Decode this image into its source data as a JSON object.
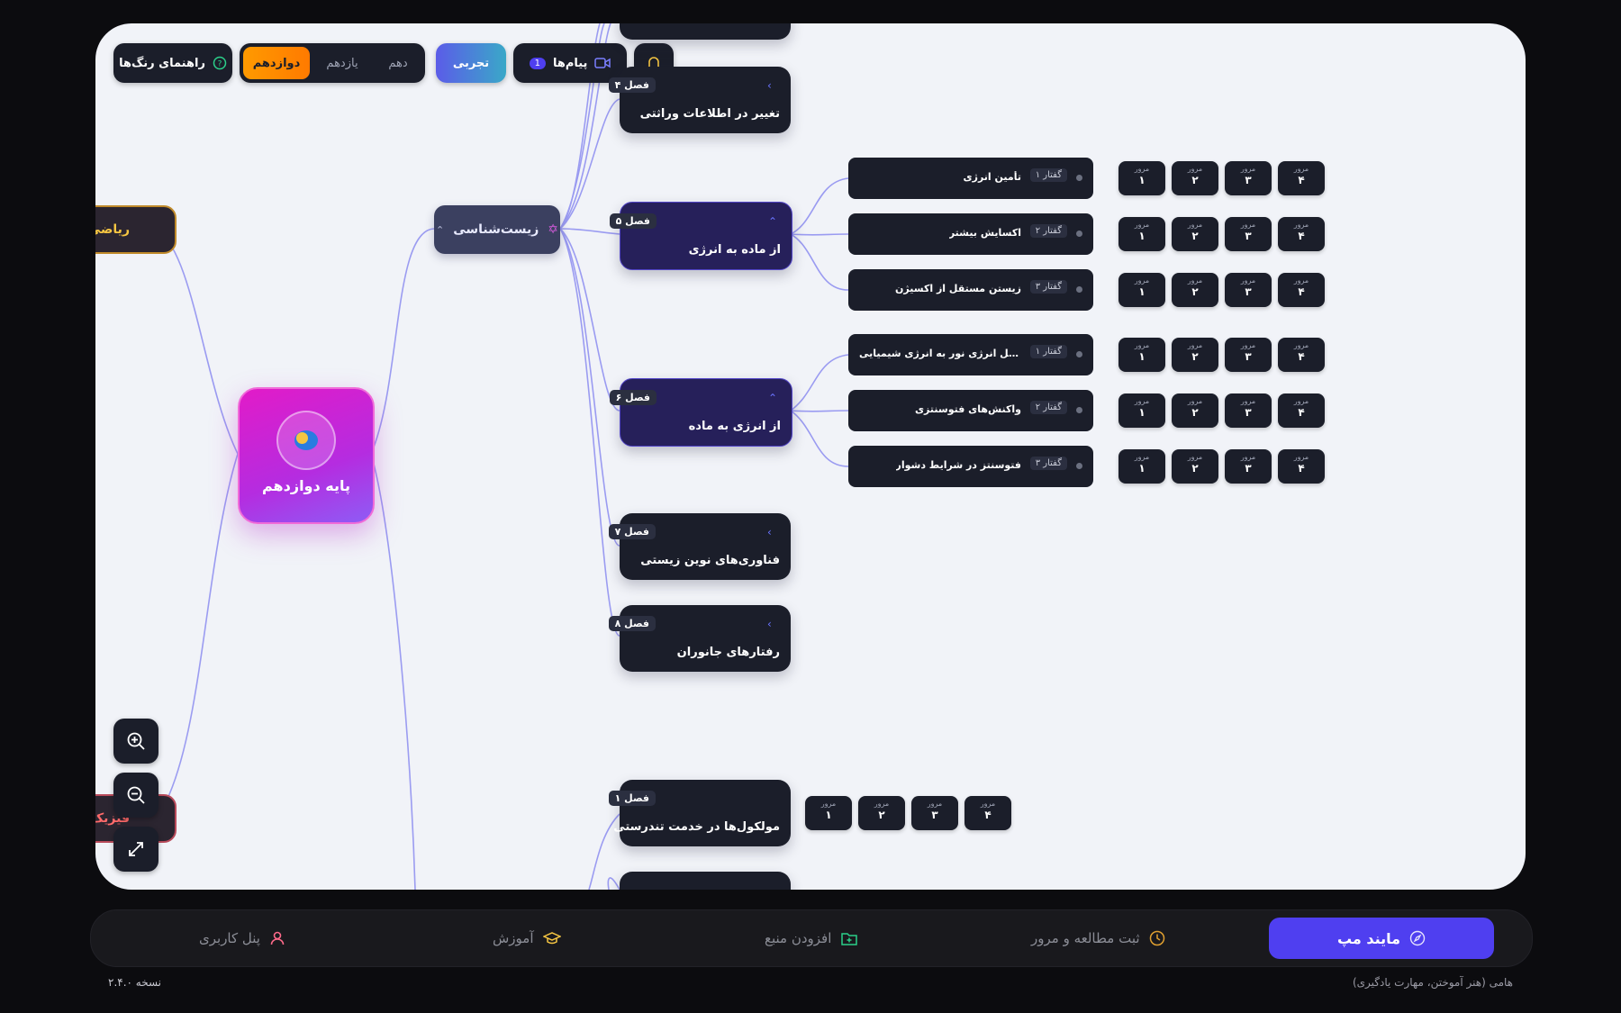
{
  "toolbar": {
    "color_guide_label": "راهنمای رنگ‌ها",
    "grades": [
      "دهم",
      "یازدهم",
      "دوازدهم"
    ],
    "active_grade": "دوازدهم",
    "track_label": "تجربی",
    "messages_label": "پیام‌ها",
    "messages_count": "1"
  },
  "map": {
    "root_title": "پایه دوازدهم",
    "subject_biology": "زیست‌شناسی",
    "subject_math": "ریاضی",
    "subject_physics": "فیزیک",
    "chapters": [
      {
        "tag": "فصل ۴",
        "title": "تغییر در اطلاعات وراثتی"
      },
      {
        "tag": "فصل ۵",
        "title": "از ماده به انرژی"
      },
      {
        "tag": "فصل ۶",
        "title": "از انرژی به ماده"
      },
      {
        "tag": "فصل ۷",
        "title": "فناوری‌های نوین زیستی"
      },
      {
        "tag": "فصل ۸",
        "title": "رفتارهای جانوران"
      },
      {
        "tag": "فصل ۱",
        "title": "مولکول‌ها در خدمت تندرستی"
      }
    ],
    "lessons": [
      {
        "tag": "گفتار ۱",
        "title": "تأمین انرژی"
      },
      {
        "tag": "گفتار ۲",
        "title": "اکسایش بیشتر"
      },
      {
        "tag": "گفتار ۳",
        "title": "زیستن مستقل از اکسیژن"
      },
      {
        "tag": "گفتار ۱",
        "title": "فتوسنتز: تبدیل انرژی نور به انرژی شیمیایی"
      },
      {
        "tag": "گفتار ۲",
        "title": "واکنش‌های فتوسنتزی"
      },
      {
        "tag": "گفتار ۳",
        "title": "فتوسنتز در شرایط دشوار"
      }
    ],
    "review_label": "مرور",
    "review_numbers": [
      "۱",
      "۲",
      "۳",
      "۴"
    ]
  },
  "nav": {
    "mindmap": "مایند مپ",
    "study_log": "ثبت مطالعه و مرور",
    "add_source": "افزودن منبع",
    "tutorial": "آموزش",
    "user_panel": "پنل کاربری"
  },
  "footer": {
    "tagline": "هامی (هنر آموختن، مهارت یادگیری)",
    "version": "نسخه ۲.۴.۰"
  },
  "colors": {
    "accent": "#4f3ff0",
    "active_grade": "#ff8a00",
    "track": "#5b5ce8",
    "root_gradient_start": "#d21bd8",
    "root_gradient_end": "#a855f7"
  }
}
